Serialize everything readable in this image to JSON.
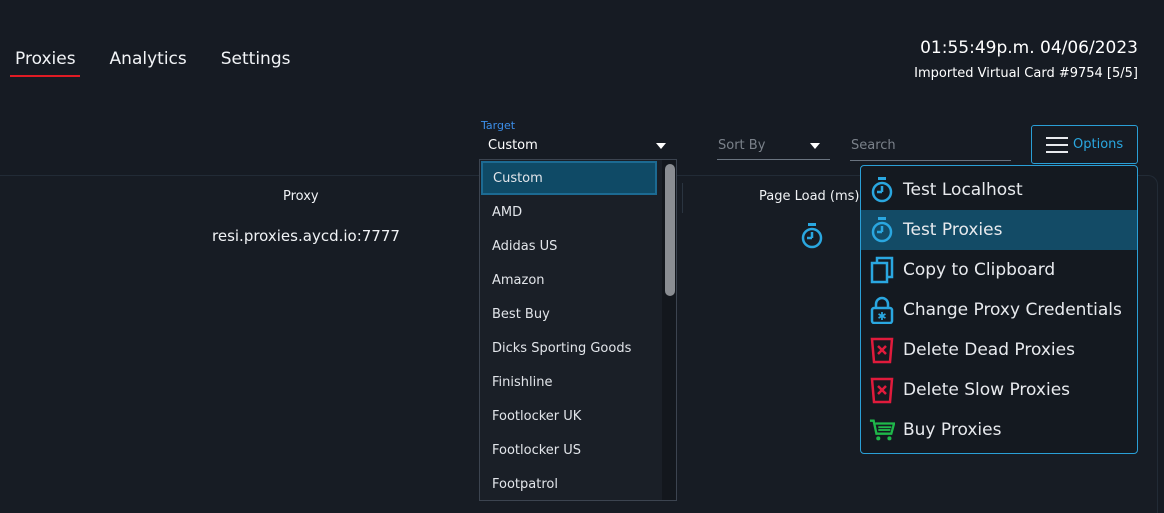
{
  "tabs": [
    {
      "label": "Proxies",
      "active": true
    },
    {
      "label": "Analytics",
      "active": false
    },
    {
      "label": "Settings",
      "active": false
    }
  ],
  "header": {
    "clock": "01:55:49p.m. 04/06/2023",
    "card": "Imported Virtual Card #9754 [5/5]"
  },
  "toolbar": {
    "target_label": "Target",
    "target_value": "Custom",
    "sort_placeholder": "Sort By",
    "search_placeholder": "Search",
    "options_label": "Options"
  },
  "table": {
    "columns": [
      "Proxy",
      "Page Load (ms)"
    ],
    "rows": [
      {
        "proxy": "resi.proxies.aycd.io:7777",
        "load_icon": "stopwatch-icon"
      }
    ]
  },
  "target_dropdown": {
    "selected": "Custom",
    "options": [
      "Custom",
      "AMD",
      "Adidas US",
      "Amazon",
      "Best Buy",
      "Dicks Sporting Goods",
      "Finishline",
      "Footlocker UK",
      "Footlocker US",
      "Footpatrol"
    ]
  },
  "options_menu": {
    "items": [
      {
        "label": "Test Localhost",
        "icon": "stopwatch-icon",
        "color": "#2aa7e0"
      },
      {
        "label": "Test Proxies",
        "icon": "stopwatch-icon",
        "color": "#2aa7e0",
        "highlighted": true
      },
      {
        "label": "Copy to Clipboard",
        "icon": "copy-icon",
        "color": "#2aa7e0"
      },
      {
        "label": "Change Proxy Credentials",
        "icon": "lock-icon",
        "color": "#2aa7e0"
      },
      {
        "label": "Delete Dead Proxies",
        "icon": "delete-icon",
        "color": "#e01b3c"
      },
      {
        "label": "Delete Slow Proxies",
        "icon": "delete-icon",
        "color": "#e01b3c"
      },
      {
        "label": "Buy Proxies",
        "icon": "cart-icon",
        "color": "#1fb84a"
      }
    ]
  },
  "colors": {
    "accent": "#2aa7e0",
    "active_tab_underline": "#e01b24",
    "highlight": "#134b66",
    "danger": "#e01b3c",
    "success": "#1fb84a"
  }
}
